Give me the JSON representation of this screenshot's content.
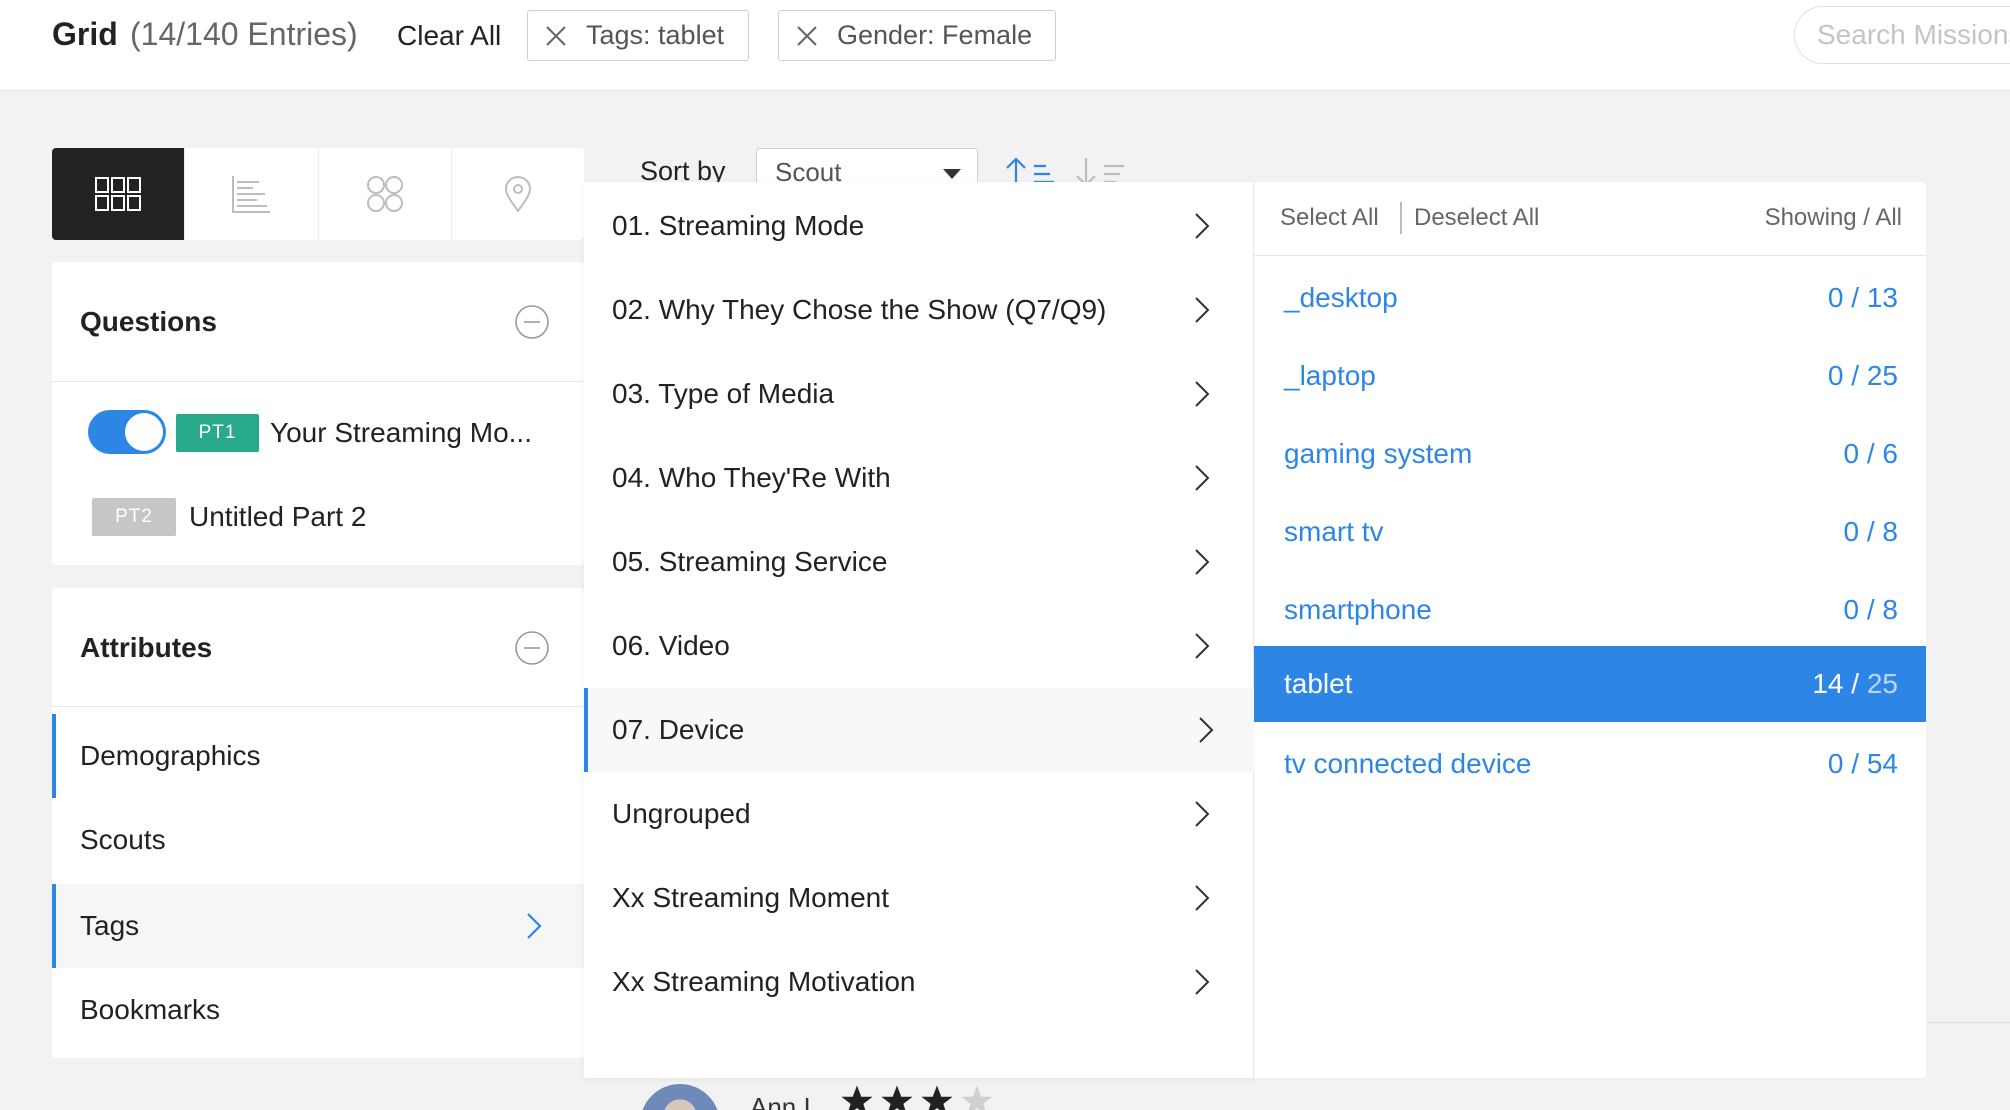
{
  "topbar": {
    "title": "Grid",
    "count": "(14/140 Entries)",
    "clear_all": "Clear All",
    "filters": [
      "Tags: tablet",
      "Gender: Female"
    ],
    "search_placeholder": "Search Missions"
  },
  "view_tabs": [
    {
      "icon": "grid-view-icon",
      "active": true
    },
    {
      "icon": "list-view-icon",
      "active": false
    },
    {
      "icon": "cluster-view-icon",
      "active": false
    },
    {
      "icon": "map-view-icon",
      "active": false
    }
  ],
  "questions": {
    "title": "Questions",
    "parts": [
      {
        "badge": "PT1",
        "label": "Your Streaming Mo...",
        "enabled": true,
        "badge_color": "#27a98a"
      },
      {
        "badge": "PT2",
        "label": "Untitled Part 2",
        "enabled": false,
        "badge_color": "#c6c6c6"
      }
    ]
  },
  "attributes": {
    "title": "Attributes",
    "items": [
      "Demographics",
      "Scouts",
      "Tags",
      "Bookmarks"
    ],
    "selected": "Tags"
  },
  "sort": {
    "label": "Sort by",
    "value": "Scout"
  },
  "tag_groups": {
    "items": [
      "01. Streaming Mode",
      "02. Why They Chose the Show (Q7/Q9)",
      "03. Type of Media",
      "04. Who They'Re With",
      "05. Streaming Service",
      "06. Video",
      "07. Device",
      "Ungrouped",
      "Xx Streaming Moment",
      "Xx Streaming Motivation"
    ],
    "active": "07. Device"
  },
  "tag_values": {
    "select_all": "Select All",
    "deselect_all": "Deselect All",
    "showing_label": "Showing / All",
    "rows": [
      {
        "name": "_desktop",
        "showing": "0",
        "all": "13"
      },
      {
        "name": "_laptop",
        "showing": "0",
        "all": "25"
      },
      {
        "name": "gaming system",
        "showing": "0",
        "all": "6"
      },
      {
        "name": "smart tv",
        "showing": "0",
        "all": "8"
      },
      {
        "name": "smartphone",
        "showing": "0",
        "all": "8"
      },
      {
        "name": "tablet",
        "showing": "14",
        "all": "25",
        "selected": true
      },
      {
        "name": "tv connected device",
        "showing": "0",
        "all": "54"
      }
    ]
  },
  "background": {
    "entry_name": "Ann I",
    "rating": 3,
    "rating_max": 4
  },
  "colors": {
    "accent": "#2d86e6",
    "pt1": "#27a98a",
    "pt2": "#c6c6c6",
    "dark": "#222222"
  }
}
